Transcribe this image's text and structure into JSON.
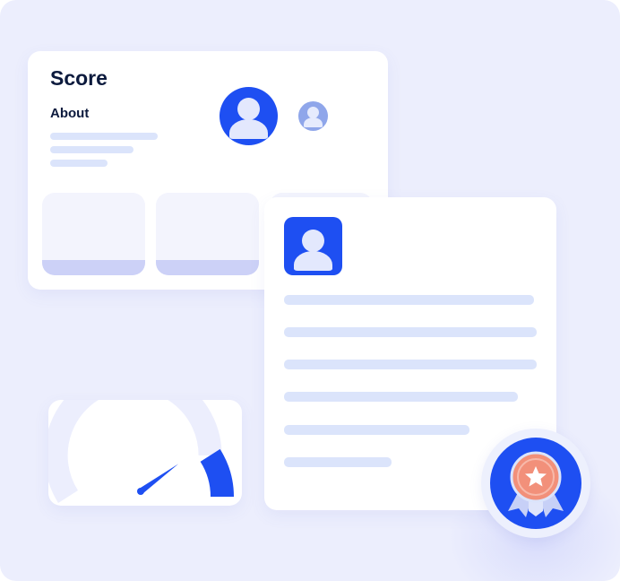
{
  "score_card": {
    "title": "Score",
    "about_label": "About",
    "avatar_main_icon": "user-avatar-icon",
    "avatar_secondary_icon": "user-avatar-icon"
  },
  "profile_card": {
    "avatar_icon": "user-avatar-icon"
  },
  "gauge": {
    "icon": "speedometer-icon",
    "level_fraction": 0.82
  },
  "badge": {
    "icon": "award-medal-icon"
  },
  "colors": {
    "background": "#eceefd",
    "card": "#ffffff",
    "primary_blue": "#1e4ff2",
    "soft_blue": "#8fa6ea",
    "placeholder": "#dbe4fb",
    "tile": "#f3f4fd",
    "tile_base": "#ccd1f7",
    "heading_text": "#0c1a3d",
    "medal_orange": "#f2907a",
    "ribbon": "#c7d0f7"
  }
}
